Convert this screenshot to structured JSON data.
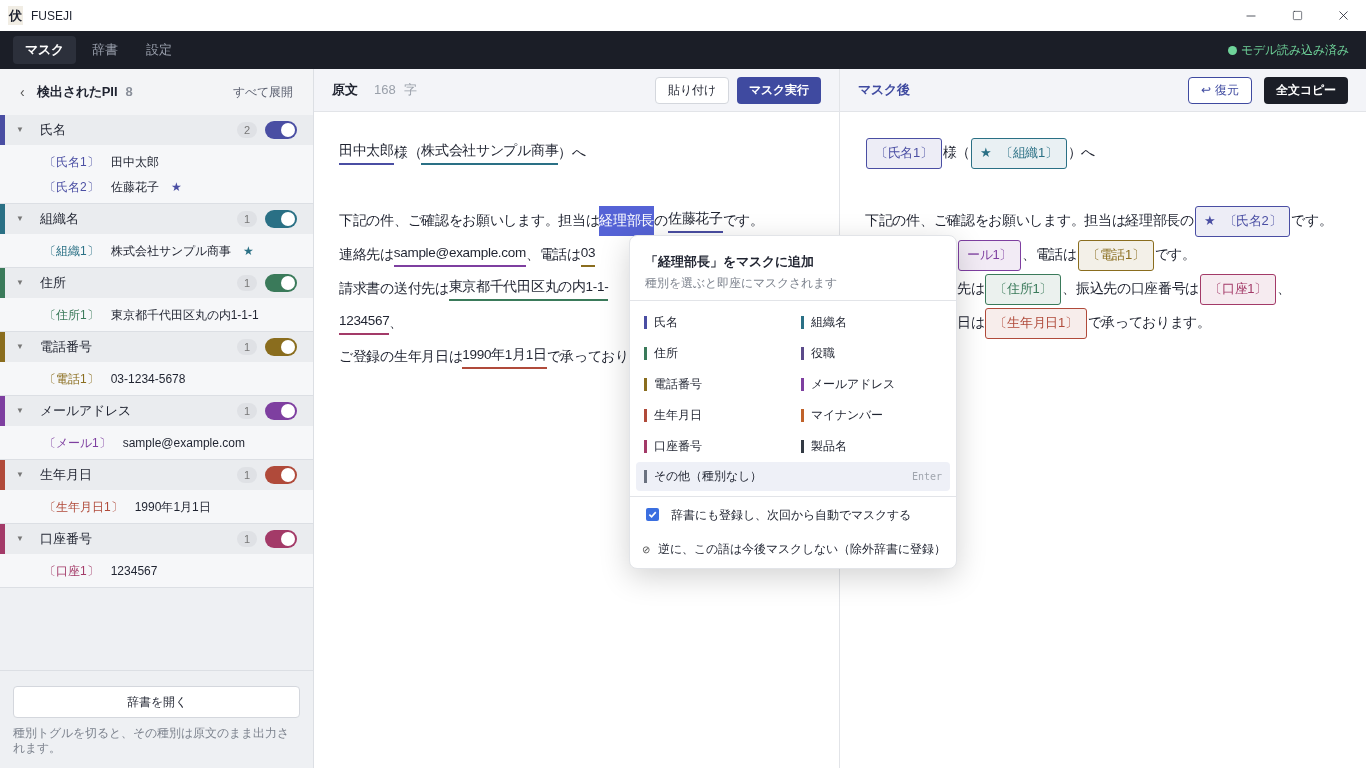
{
  "window": {
    "logo": "伏",
    "title": "FUSEJI"
  },
  "nav": {
    "tabs": [
      {
        "label": "マスク",
        "selected": true
      },
      {
        "label": "辞書",
        "selected": false
      },
      {
        "label": "設定",
        "selected": false
      }
    ],
    "status": "モデル読み込み済み",
    "status_ok": true
  },
  "sidebar": {
    "back": "‹",
    "title": "検出されたPII",
    "count": "8",
    "expand_all": "すべて展開",
    "groups": [
      {
        "chevron": "▼",
        "label": "氏名",
        "count": "2",
        "on": true,
        "color": "#4a4ea3",
        "items": [
          {
            "tag": "〔氏名1〕",
            "value": "田中太郎"
          },
          {
            "tag": "〔氏名2〕",
            "value": "佐藤花子",
            "star": "★"
          }
        ]
      },
      {
        "chevron": "▼",
        "label": "組織名",
        "count": "1",
        "on": true,
        "color": "#2a7085",
        "items": [
          {
            "tag": "〔組織1〕",
            "value": "株式会社サンプル商事",
            "star": "★"
          }
        ]
      },
      {
        "chevron": "▼",
        "label": "住所",
        "count": "1",
        "on": true,
        "color": "#3a7a5a",
        "items": [
          {
            "tag": "〔住所1〕",
            "value": "東京都千代田区丸の内1-1-1"
          }
        ]
      },
      {
        "chevron": "▼",
        "label": "電話番号",
        "count": "1",
        "on": true,
        "color": "#8a6d1e",
        "items": [
          {
            "tag": "〔電話1〕",
            "value": "03-1234-5678"
          }
        ]
      },
      {
        "chevron": "▼",
        "label": "メールアドレス",
        "count": "1",
        "on": true,
        "color": "#7e3fa0",
        "items": [
          {
            "tag": "〔メール1〕",
            "value": "sample@example.com"
          }
        ]
      },
      {
        "chevron": "▼",
        "label": "生年月日",
        "count": "1",
        "on": true,
        "color": "#b04a3a",
        "items": [
          {
            "tag": "〔生年月日1〕",
            "value": "1990年1月1日"
          }
        ]
      },
      {
        "chevron": "▼",
        "label": "口座番号",
        "count": "1",
        "on": true,
        "color": "#a33a68",
        "items": [
          {
            "tag": "〔口座1〕",
            "value": "1234567"
          }
        ]
      }
    ],
    "open_dictionary": "辞書を開く",
    "note": "種別トグルを切ると、その種別は原文のまま出力されます。"
  },
  "source": {
    "title": "原文",
    "count": "168",
    "unit": "字",
    "paste": "貼り付け",
    "run": "マスク実行",
    "lines": [
      {
        "kind": "text",
        "parts": [
          {
            "text": "田中太郎",
            "color": "#4a4ea3"
          },
          {
            "text": "様（"
          },
          {
            "text": "株式会社サンプル商事",
            "color": "#2a7085"
          },
          {
            "text": "）へ"
          }
        ]
      },
      {
        "kind": "blank"
      },
      {
        "kind": "text",
        "parts": [
          {
            "text": "下記の件、ご確認をお願いします。担当は"
          },
          {
            "text": "経理部長",
            "selected": true
          },
          {
            "text": "の"
          },
          {
            "text": "佐藤花子",
            "color": "#4a4ea3"
          },
          {
            "text": "です。"
          }
        ]
      },
      {
        "kind": "text",
        "parts": [
          {
            "text": "連絡先は "
          },
          {
            "text": "sample@example.com",
            "color": "#7e3fa0"
          },
          {
            "text": "、電話は "
          },
          {
            "text": "03",
            "color": "#8a6d1e"
          }
        ]
      },
      {
        "kind": "text",
        "parts": [
          {
            "text": "請求書の送付先は"
          },
          {
            "text": "東京都千代田区丸の内1-1-",
            "color": "#3a7a5a"
          }
        ]
      },
      {
        "kind": "text",
        "parts": [
          {
            "text": "1234567",
            "color": "#a33a68"
          },
          {
            "text": "、"
          }
        ]
      },
      {
        "kind": "text",
        "parts": [
          {
            "text": "ご登録の生年月日は"
          },
          {
            "text": "1990年1月1日",
            "color": "#b04a3a"
          },
          {
            "text": "で承っており"
          }
        ]
      }
    ]
  },
  "masked": {
    "title": "マスク後",
    "restore_icon": "↩",
    "restore": "復元",
    "copy": "全文コピー",
    "lines": [
      {
        "kind": "text",
        "cut": false,
        "parts": [
          {
            "kind": "chip",
            "text": "〔氏名1〕",
            "color": "#4a4ea3"
          },
          {
            "kind": "text",
            "text": "様（"
          },
          {
            "kind": "chip",
            "star": "★",
            "text": "〔組織1〕",
            "color": "#2a7085"
          },
          {
            "kind": "text",
            "text": "）へ"
          }
        ]
      },
      {
        "kind": "blank"
      },
      {
        "kind": "text",
        "cut": false,
        "parts": [
          {
            "kind": "text",
            "text": "下記の件、ご確認をお願いします。担当は経理部長の"
          },
          {
            "kind": "chip",
            "star": "★",
            "text": "〔氏名2〕",
            "color": "#4a4ea3"
          },
          {
            "kind": "text",
            "text": "です。"
          }
        ]
      },
      {
        "kind": "text",
        "cut": true,
        "parts": [
          {
            "kind": "chip",
            "text": "ール1〕",
            "color": "#7e3fa0"
          },
          {
            "kind": "text",
            "text": "、電話は"
          },
          {
            "kind": "chip",
            "text": "〔電話1〕",
            "color": "#8a6d1e"
          },
          {
            "kind": "text",
            "text": "です。"
          }
        ]
      },
      {
        "kind": "text",
        "cut": true,
        "parts": [
          {
            "kind": "text",
            "text": "先は"
          },
          {
            "kind": "chip",
            "text": "〔住所1〕",
            "color": "#3a7a5a"
          },
          {
            "kind": "text",
            "text": "、振込先の口座番号は"
          },
          {
            "kind": "chip",
            "text": "〔口座1〕",
            "color": "#a33a68"
          },
          {
            "kind": "text",
            "text": "、"
          }
        ]
      },
      {
        "kind": "text",
        "cut": true,
        "parts": [
          {
            "kind": "text",
            "text": "日は"
          },
          {
            "kind": "chip",
            "text": "〔生年月日1〕",
            "color": "#b04a3a"
          },
          {
            "kind": "text",
            "text": "で承っております。"
          }
        ]
      }
    ]
  },
  "popup": {
    "title": "「経理部長」をマスクに追加",
    "subtitle": "種別を選ぶと即座にマスクされます",
    "options": [
      {
        "label": "氏名",
        "color": "#4a4ea3",
        "selected": false
      },
      {
        "label": "組織名",
        "color": "#2a7085",
        "selected": false
      },
      {
        "label": "住所",
        "color": "#3a7a5a",
        "selected": false
      },
      {
        "label": "役職",
        "color": "#5b4a8a",
        "selected": false
      },
      {
        "label": "電話番号",
        "color": "#8a6d1e",
        "selected": false
      },
      {
        "label": "メールアドレス",
        "color": "#7e3fa0",
        "selected": false
      },
      {
        "label": "生年月日",
        "color": "#b04a3a",
        "selected": false
      },
      {
        "label": "マイナンバー",
        "color": "#c0622a",
        "selected": false
      },
      {
        "label": "口座番号",
        "color": "#a33a68",
        "selected": false
      },
      {
        "label": "製品名",
        "color": "#333a44",
        "selected": false
      }
    ],
    "other": {
      "label": "その他（種別なし）",
      "color": "#6b7280",
      "selected": true,
      "hint": "Enter"
    },
    "register": {
      "label": "辞書にも登録し、次回から自動でマスクする",
      "checked": true
    },
    "exclude_icon": "⊘",
    "exclude": "逆に、この語は今後マスクしない（除外辞書に登録）"
  }
}
